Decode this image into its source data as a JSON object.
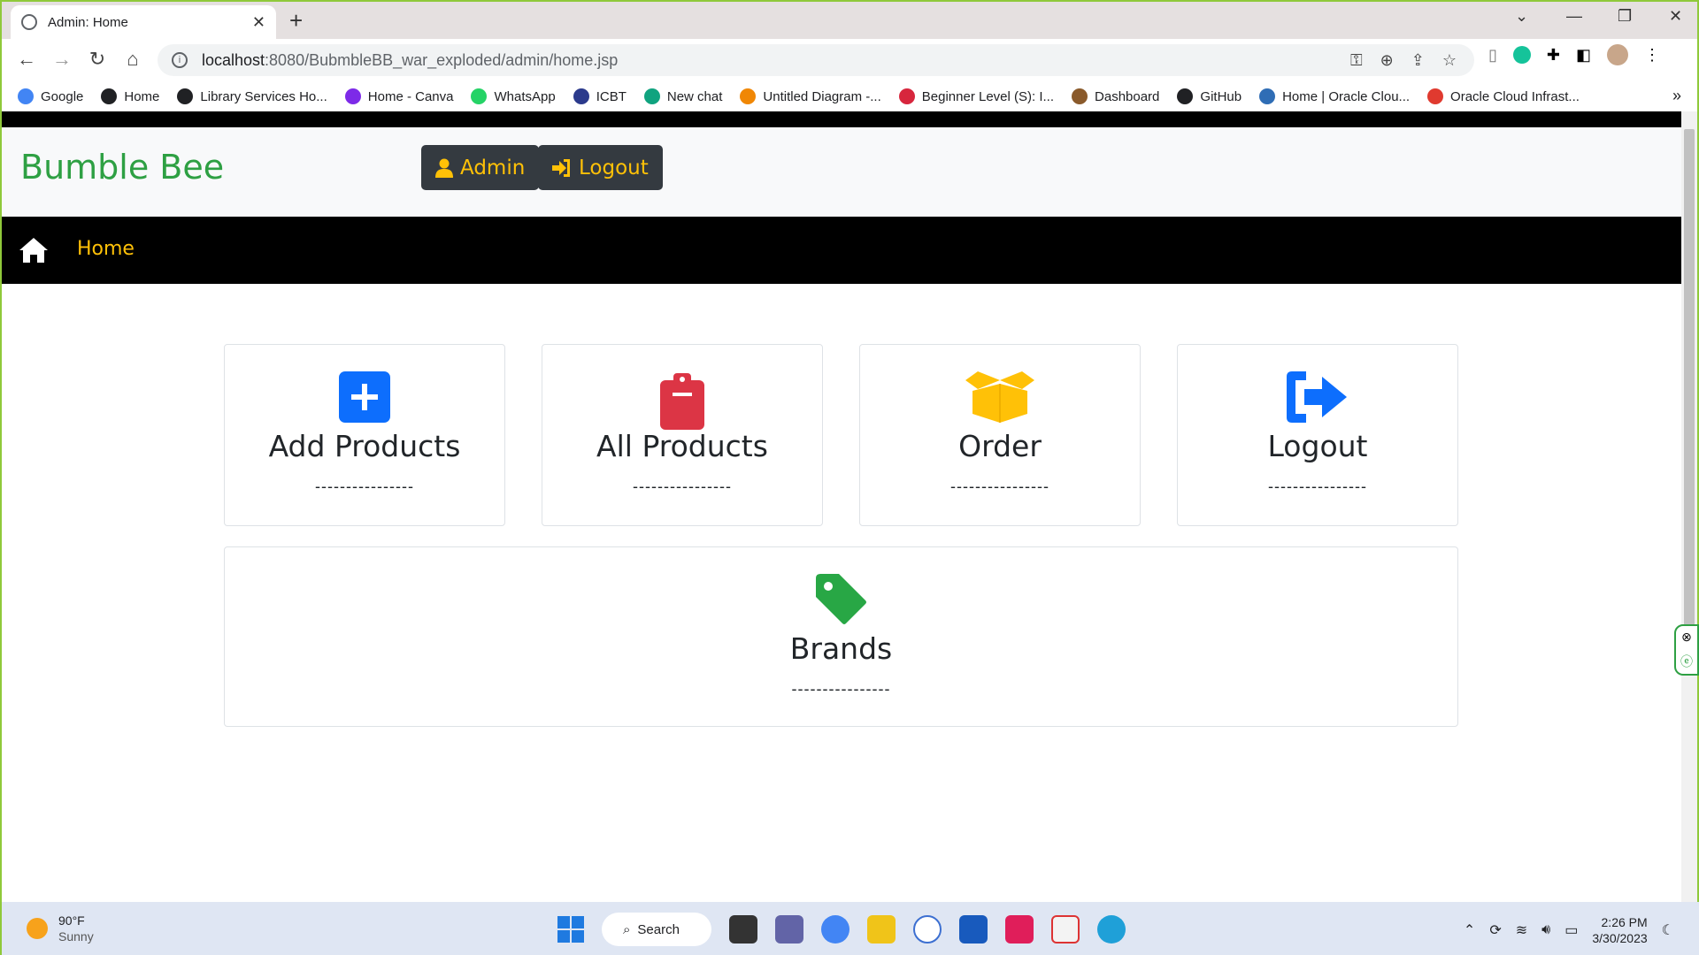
{
  "browser": {
    "tab_title": "Admin: Home",
    "url_host": "localhost",
    "url_rest": ":8080/BubmbleBB_war_exploded/admin/home.jsp",
    "bookmarks": [
      {
        "label": "Google",
        "color": "#4285f4"
      },
      {
        "label": "Home",
        "color": "#202124"
      },
      {
        "label": "Library Services Ho...",
        "color": "#202124"
      },
      {
        "label": "Home - Canva",
        "color": "#7d2ae8"
      },
      {
        "label": "WhatsApp",
        "color": "#25d366"
      },
      {
        "label": "ICBT",
        "color": "#2b3a8c"
      },
      {
        "label": "New chat",
        "color": "#10a37f"
      },
      {
        "label": "Untitled Diagram -...",
        "color": "#f08705"
      },
      {
        "label": "Beginner Level (S): I...",
        "color": "#d7263d"
      },
      {
        "label": "Dashboard",
        "color": "#8a5a2b"
      },
      {
        "label": "GitHub",
        "color": "#202124"
      },
      {
        "label": "Home | Oracle Clou...",
        "color": "#2f6db5"
      },
      {
        "label": "Oracle Cloud Infrast...",
        "color": "#e03a2f"
      }
    ]
  },
  "header": {
    "brand": "Bumble Bee",
    "admin_label": "Admin",
    "logout_label": "Logout"
  },
  "nav": {
    "home_label": "Home"
  },
  "cards": [
    {
      "label": "Add Products",
      "dash": "----------------",
      "icon": "plus-square-icon",
      "color": "#0d6efd"
    },
    {
      "label": "All Products",
      "dash": "----------------",
      "icon": "clipboard-icon",
      "color": "#dc3545"
    },
    {
      "label": "Order",
      "dash": "----------------",
      "icon": "box-open-icon",
      "color": "#ffc107"
    },
    {
      "label": "Logout",
      "dash": "----------------",
      "icon": "sign-out-icon",
      "color": "#0d6efd"
    },
    {
      "label": "Brands",
      "dash": "----------------",
      "icon": "tag-icon",
      "color": "#28a745"
    }
  ],
  "taskbar": {
    "temp": "90°F",
    "condition": "Sunny",
    "search_label": "Search",
    "time": "2:26 PM",
    "date": "3/30/2023"
  }
}
